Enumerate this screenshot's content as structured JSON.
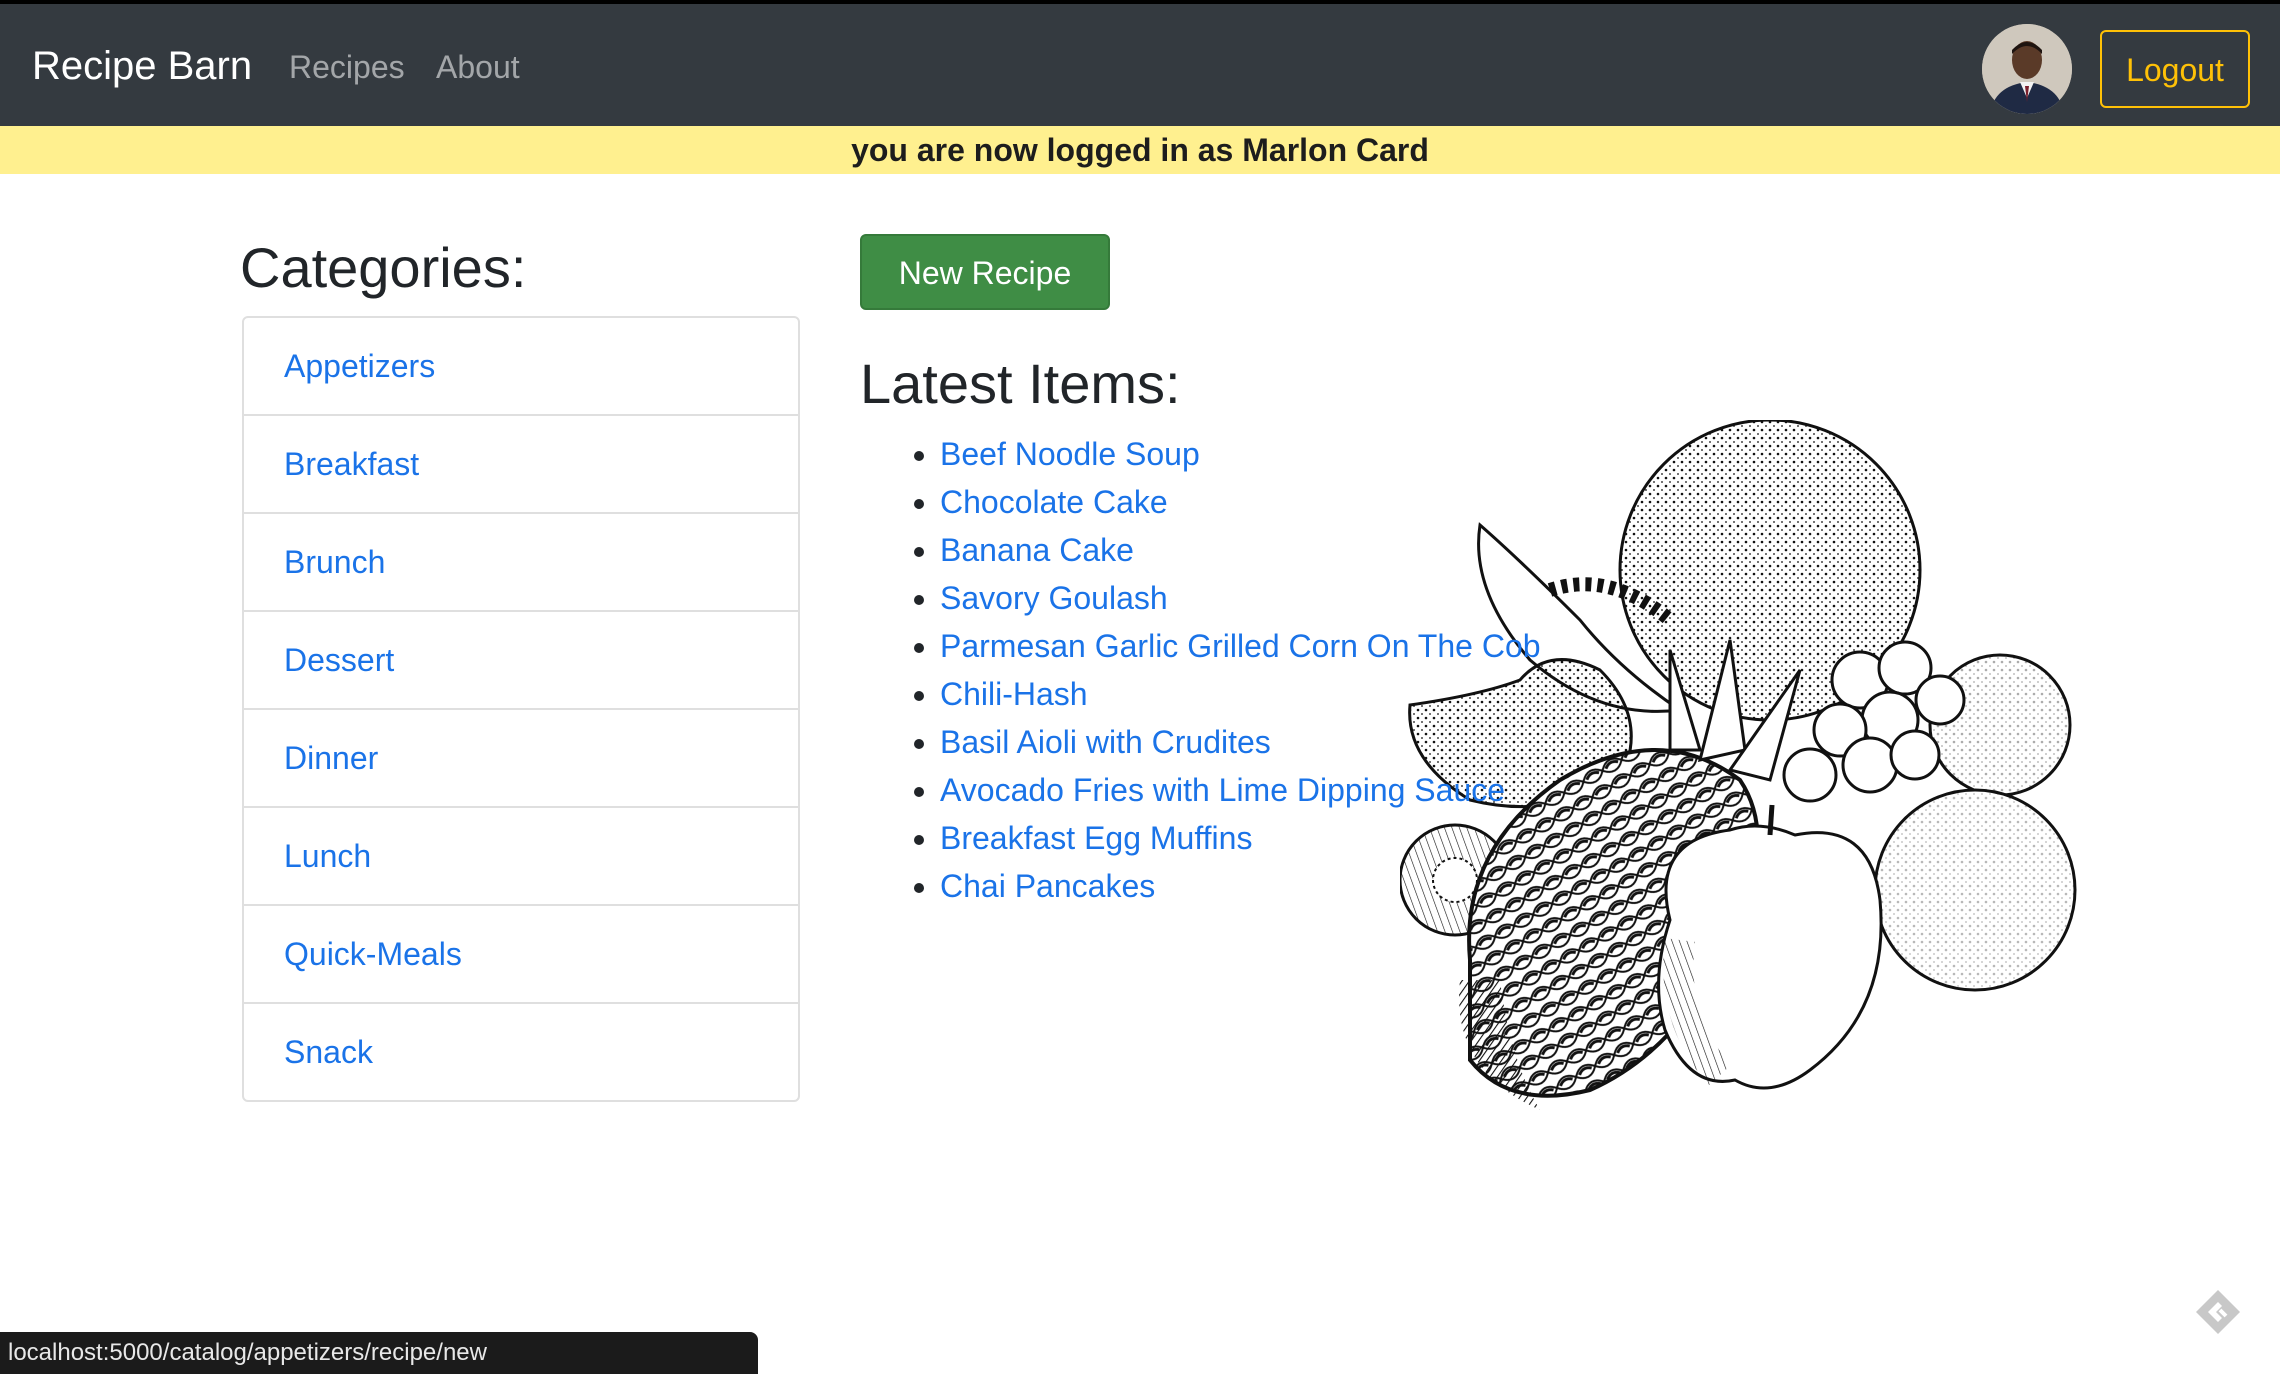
{
  "navbar": {
    "brand": "Recipe Barn",
    "links": [
      {
        "label": "Recipes"
      },
      {
        "label": "About"
      }
    ],
    "logout_label": "Logout"
  },
  "flash": {
    "message": "you are now logged in as Marlon Card"
  },
  "sidebar": {
    "title": "Categories:",
    "items": [
      {
        "label": "Appetizers"
      },
      {
        "label": "Breakfast"
      },
      {
        "label": "Brunch"
      },
      {
        "label": "Dessert"
      },
      {
        "label": "Dinner"
      },
      {
        "label": "Lunch"
      },
      {
        "label": "Quick-Meals"
      },
      {
        "label": "Snack"
      }
    ]
  },
  "main": {
    "new_recipe_label": "New Recipe",
    "latest_title": "Latest Items:",
    "latest_items": [
      {
        "label": "Beef Noodle Soup"
      },
      {
        "label": "Chocolate Cake"
      },
      {
        "label": "Banana Cake"
      },
      {
        "label": "Savory Goulash"
      },
      {
        "label": "Parmesan Garlic Grilled Corn On The Cob"
      },
      {
        "label": "Chili-Hash"
      },
      {
        "label": "Basil Aioli with Crudites"
      },
      {
        "label": "Avocado Fries with Lime Dipping Sauce"
      },
      {
        "label": "Breakfast Egg Muffins"
      },
      {
        "label": "Chai Pancakes"
      }
    ]
  },
  "status_bar": {
    "url": "localhost:5000/catalog/appetizers/recipe/new"
  },
  "icons": {
    "avatar": "user-avatar",
    "illustration": "fruit-illustration-icon",
    "corner": "extension-tag-icon"
  },
  "colors": {
    "navbar_bg": "#343a40",
    "flash_bg": "#fff08f",
    "link": "#1a73e8",
    "logout": "#ffc107",
    "new_recipe_bg": "#3f8d45"
  }
}
